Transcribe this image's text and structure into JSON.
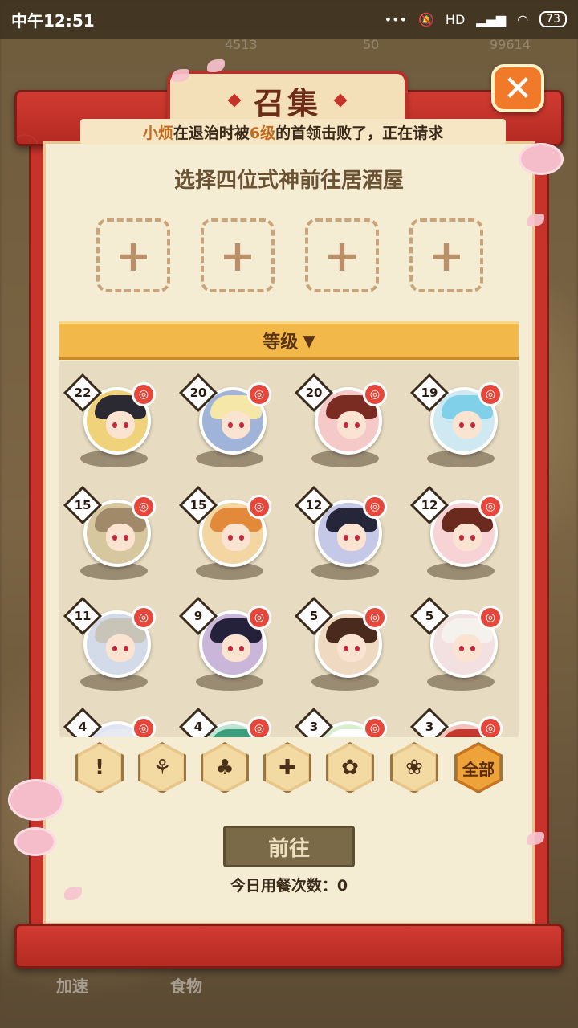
{
  "status_bar": {
    "time": "中午12:51",
    "icons": [
      "mute-icon",
      "signal-icon",
      "wifi-icon"
    ],
    "network": "HD",
    "battery": "73"
  },
  "background": {
    "currency_left": "4513",
    "currency_mid": "50",
    "currency_right": "99614",
    "tab_speed": "加速",
    "tab_food": "食物"
  },
  "dialog": {
    "title": "召集",
    "marquee": {
      "name": "小烦",
      "text_before": "在退治时被",
      "level": "6级",
      "text_after": "的首领击败了，正在请求"
    },
    "subtitle": "选择四位式神前往居酒屋",
    "slot_symbol": "+",
    "sort_label": "等级",
    "close_symbol": "✕",
    "go_button": "前往",
    "meal_count": "今日用餐次数：0",
    "filter_all": "全部"
  },
  "shikigami": [
    {
      "level": "22",
      "hair": "#2b2a33",
      "bg": "#f0d27a"
    },
    {
      "level": "20",
      "hair": "#f4e7a8",
      "bg": "#9fb4d8"
    },
    {
      "level": "20",
      "hair": "#7a2c22",
      "bg": "#f6c9c9"
    },
    {
      "level": "19",
      "hair": "#7fd0e8",
      "bg": "#cfe9f2"
    },
    {
      "level": "15",
      "hair": "#a08a6a",
      "bg": "#d7c79e"
    },
    {
      "level": "15",
      "hair": "#e2893a",
      "bg": "#f4d6a2"
    },
    {
      "level": "12",
      "hair": "#25263a",
      "bg": "#c5c8e6"
    },
    {
      "level": "12",
      "hair": "#6b2a1e",
      "bg": "#f7d3d6"
    },
    {
      "level": "11",
      "hair": "#c9c4b8",
      "bg": "#d3dbe8"
    },
    {
      "level": "9",
      "hair": "#23223a",
      "bg": "#c9b6d9"
    },
    {
      "level": "5",
      "hair": "#4a2a1c",
      "bg": "#f0d9c1"
    },
    {
      "level": "5",
      "hair": "#f5f2ee",
      "bg": "#f3e1e1"
    },
    {
      "level": "4",
      "hair": "#e8eaf2",
      "bg": "#dfe4f5"
    },
    {
      "level": "4",
      "hair": "#3a9d7c",
      "bg": "#bfe6d5"
    },
    {
      "level": "3",
      "hair": "#ffffff",
      "bg": "#d9f0d0"
    },
    {
      "level": "3",
      "hair": "#c43a2f",
      "bg": "#f4c4bc"
    }
  ],
  "filters": [
    "blade-icon",
    "two-leaf-icon",
    "three-leaf-icon",
    "four-leaf-icon",
    "five-petal-icon",
    "six-petal-icon"
  ]
}
